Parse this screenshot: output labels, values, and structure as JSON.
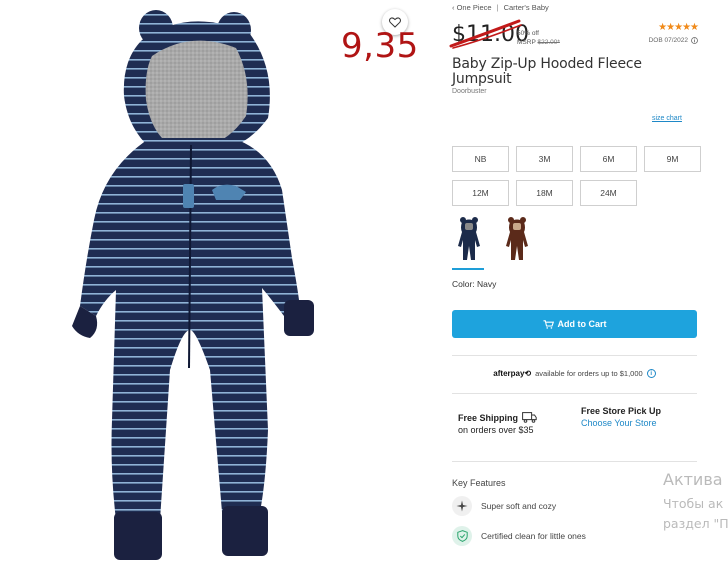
{
  "overlay": {
    "price_note": "9,35"
  },
  "breadcrumb": {
    "back": "‹ One Piece",
    "sep": "|",
    "brand": "Carter's",
    "category": "Baby"
  },
  "pricing": {
    "sale_price": "$11.00",
    "discount": "50% off",
    "msrp_label": "MSRP",
    "msrp_value": "$22.00*",
    "strike_color": "#c21a1a"
  },
  "rating": {
    "stars": "★★★★★",
    "dob": "DOB 07/2022"
  },
  "product": {
    "title": "Baby Zip-Up Hooded Fleece Jumpsuit",
    "subtitle": "Doorbuster"
  },
  "size_chart_label": "size chart",
  "sizes": [
    "NB",
    "3M",
    "6M",
    "9M",
    "12M",
    "18M",
    "24M"
  ],
  "swatches": [
    {
      "name": "navy-swatch",
      "color": "#1c2b4a",
      "selected": true
    },
    {
      "name": "brown-swatch",
      "color": "#5b2a1a",
      "selected": false
    }
  ],
  "color_label": "Color: Navy",
  "cart": {
    "label": "Add to Cart",
    "color": "#1ea3dd"
  },
  "afterpay": {
    "logo": "afterpay⟲",
    "text": "available for orders up to $1,000"
  },
  "shipping": {
    "free_shipping": "Free Shipping",
    "free_shipping_sub": "on orders over $35",
    "pickup": "Free Store Pick Up",
    "pickup_link": "Choose Your Store"
  },
  "features": {
    "heading": "Key Features",
    "items": [
      "Super soft and cozy",
      "Certified clean for little ones"
    ]
  },
  "watermark": {
    "line1": "Актива",
    "line2": "Чтобы ак",
    "line3": "раздел \"П"
  }
}
